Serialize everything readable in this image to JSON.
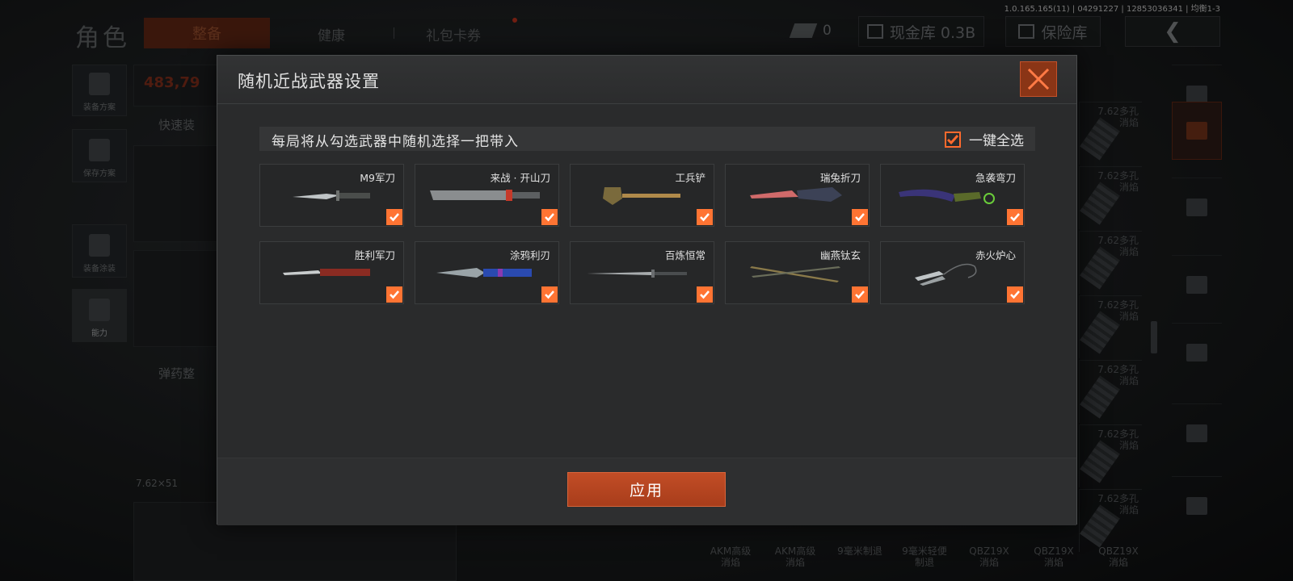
{
  "version_text": "1.0.165.165(11) | 04291227 | 12853036341 | 均衡1-3",
  "background": {
    "page_title": "角色",
    "tabs": [
      "整备",
      "健康",
      "礼包卡券"
    ],
    "ticket_count": "0",
    "cash_label": "现金库 0.3B",
    "vault_label": "保险库",
    "side_buttons": [
      "装备方案",
      "保存方案",
      "装备涂装",
      "能力"
    ],
    "value_label": "483,79",
    "quick_label": "快速装",
    "ammo_section_label": "弹药整",
    "ammo_type": "7.62×51",
    "grid_label": "7.62多孔\n消焰",
    "bottom_labels": [
      "AKM高级\n消焰",
      "AKM高级\n消焰",
      "9毫米制退",
      "9毫米轻便\n制退",
      "QBZ19X\n消焰",
      "QBZ19X\n消焰",
      "QBZ19X\n消焰"
    ]
  },
  "modal": {
    "title": "随机近战武器设置",
    "info_text": "每局将从勾选武器中随机选择一把带入",
    "select_all_label": "一键全选",
    "select_all_checked": true,
    "apply_label": "应用",
    "accent_color": "#ff7433",
    "close_icon": "close-x-icon",
    "weapons": [
      {
        "name": "M9军刀",
        "checked": true
      },
      {
        "name": "来战 · 开山刀",
        "checked": true
      },
      {
        "name": "工兵铲",
        "checked": true
      },
      {
        "name": "瑞兔折刀",
        "checked": true
      },
      {
        "name": "急袭弯刀",
        "checked": true
      },
      {
        "name": "胜利军刀",
        "checked": true
      },
      {
        "name": "涂鸦利刃",
        "checked": true
      },
      {
        "name": "百炼恒常",
        "checked": true
      },
      {
        "name": "幽燕钛玄",
        "checked": true
      },
      {
        "name": "赤火炉心",
        "checked": true
      }
    ]
  }
}
